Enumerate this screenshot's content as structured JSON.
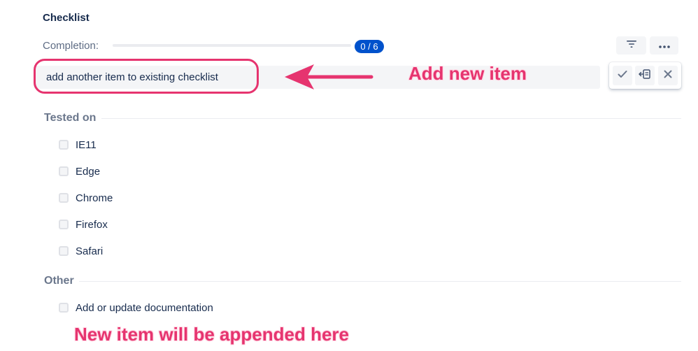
{
  "checklist": {
    "title": "Checklist",
    "completion_label": "Completion:",
    "completed": 0,
    "total": 6,
    "badge": "0 / 6",
    "colors": {
      "accent": "#0052cc",
      "annotation": "#e6346f"
    }
  },
  "toolbar": {
    "filter_icon": "filter-icon",
    "more_icon": "more-horizontal-icon"
  },
  "new_item": {
    "value": "add another item to existing checklist",
    "placeholder": "",
    "actions": [
      {
        "name": "confirm-button",
        "icon": "check-icon"
      },
      {
        "name": "add-to-section-button",
        "icon": "insert-icon"
      },
      {
        "name": "cancel-button",
        "icon": "close-icon"
      }
    ]
  },
  "sections": [
    {
      "title": "Tested on",
      "items": [
        {
          "label": "IE11",
          "checked": false
        },
        {
          "label": "Edge",
          "checked": false
        },
        {
          "label": "Chrome",
          "checked": false
        },
        {
          "label": "Firefox",
          "checked": false
        },
        {
          "label": "Safari",
          "checked": false
        }
      ]
    },
    {
      "title": "Other",
      "items": [
        {
          "label": "Add or update documentation",
          "checked": false
        }
      ]
    }
  ],
  "annotations": {
    "add_new_item": "Add new item",
    "appended_here": "New item will be appended here"
  }
}
